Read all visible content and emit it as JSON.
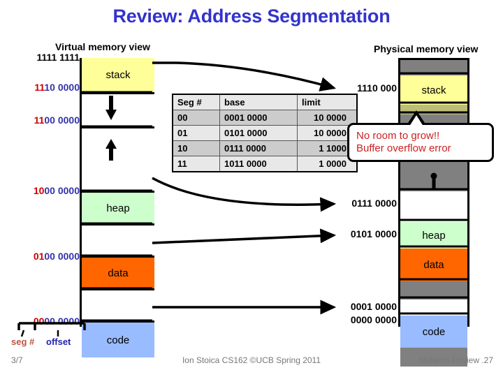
{
  "slide": {
    "title": "Review: Address Segmentation"
  },
  "virtual": {
    "caption": "Virtual memory view",
    "addresses": [
      {
        "seg": "",
        "off": "",
        "full": "1111 1111",
        "plain": true
      },
      {
        "seg": "11",
        "off": "10 0000",
        "plain": false
      },
      {
        "seg": "11",
        "off": "00 0000",
        "plain": false
      },
      {
        "seg": "10",
        "off": "00 0000",
        "plain": false
      },
      {
        "seg": "01",
        "off": "00 0000",
        "plain": false
      },
      {
        "seg": "00",
        "off": "00 0000",
        "plain": false
      }
    ],
    "blocks": [
      {
        "label": "stack",
        "color": "#ffff99"
      },
      {
        "label": "",
        "color": "#ffffff"
      },
      {
        "label": "",
        "color": "#ffffff"
      },
      {
        "label": "heap",
        "color": "#ccffcc"
      },
      {
        "label": "",
        "color": "#ffffff"
      },
      {
        "label": "data",
        "color": "#ff6600"
      },
      {
        "label": "",
        "color": "#ffffff"
      },
      {
        "label": "code",
        "color": "#99bbff"
      }
    ]
  },
  "physical": {
    "caption": "Physical memory view",
    "addresses": [
      {
        "text": "1110 000",
        "arrow": true
      },
      {
        "text": "0111 0000",
        "arrow": true
      },
      {
        "text": "0101 0000",
        "arrow": true
      },
      {
        "text": "0001 0000",
        "arrow": false
      },
      {
        "text": "0000 0000",
        "arrow": false
      }
    ],
    "blocks": [
      {
        "label": "",
        "color": "#808080"
      },
      {
        "label": "stack",
        "color": "#ffff99"
      },
      {
        "label": "",
        "color": "#bdbd7a"
      },
      {
        "label": "",
        "color": "#808080"
      },
      {
        "label": "",
        "color": "#808080"
      },
      {
        "label": "",
        "color": "#ffffff"
      },
      {
        "label": "heap",
        "color": "#ccffcc"
      },
      {
        "label": "data",
        "color": "#ff6600"
      },
      {
        "label": "",
        "color": "#808080"
      },
      {
        "label": "",
        "color": "#ffffff"
      },
      {
        "label": "code",
        "color": "#99bbff"
      },
      {
        "label": "",
        "color": "#808080"
      }
    ]
  },
  "seg_table": {
    "headers": [
      "Seg #",
      "base",
      "limit"
    ],
    "rows": [
      {
        "seg": "00",
        "base": "0001 0000",
        "limit": "10 0000"
      },
      {
        "seg": "01",
        "base": "0101 0000",
        "limit": "10 0000"
      },
      {
        "seg": "10",
        "base": "0111 0000",
        "limit": "1 1000"
      },
      {
        "seg": "11",
        "base": "1011 0000",
        "limit": "1 0000"
      }
    ]
  },
  "callout": {
    "line1": "No room to grow!!",
    "line2": "Buffer overflow error",
    "color": "#cc2222"
  },
  "legend": {
    "seg_label": "seg #",
    "offset_label": "offset"
  },
  "footer": {
    "left": "3/7",
    "center": "Ion Stoica CS162 ©UCB Spring 2011",
    "right": "Midterm Review .27"
  },
  "colors": {
    "title": "#3333cc",
    "seg_digits": "#cc0000",
    "offset_digits": "#3333aa",
    "stack": "#ffff99",
    "heap": "#ccffcc",
    "data": "#ff6600",
    "code": "#99bbff",
    "gray": "#808080"
  }
}
